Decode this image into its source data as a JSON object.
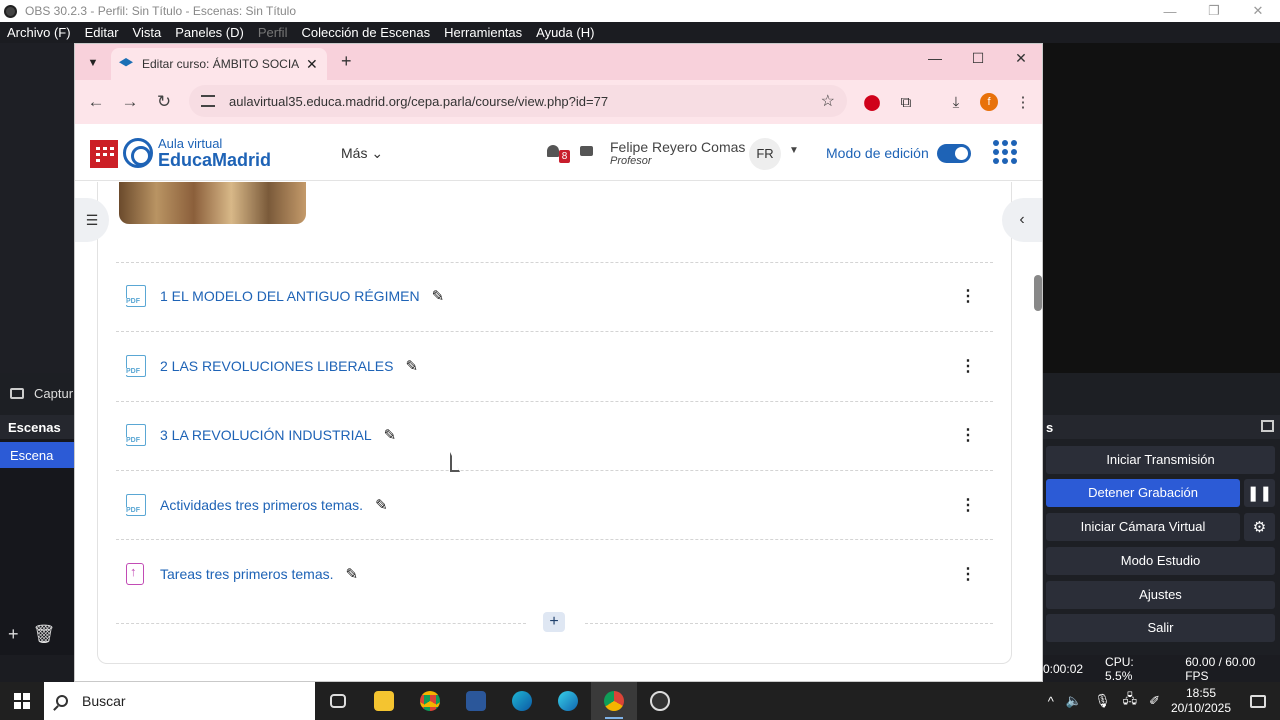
{
  "obs": {
    "title": "OBS 30.2.3 - Perfil: Sin Título - Escenas: Sin Título",
    "menu": [
      "Archivo (F)",
      "Editar",
      "Vista",
      "Paneles (D)",
      "Perfil",
      "Colección de Escenas",
      "Herramientas",
      "Ayuda (H)"
    ],
    "source_label": "Captur",
    "scenes_header": "Escenas",
    "scene_item": "Escena",
    "controls_header": "s",
    "controls": {
      "start_stream": "Iniciar Transmisión",
      "stop_record": "Detener Grabación",
      "virtual_cam": "Iniciar Cámara Virtual",
      "studio_mode": "Modo Estudio",
      "settings": "Ajustes",
      "exit": "Salir"
    },
    "status": {
      "rec_time": "0:00:02",
      "cpu": "CPU: 5.5%",
      "fps": "60.00 / 60.00 FPS"
    }
  },
  "chrome": {
    "tab_title": "Editar curso: ÁMBITO SOCIAL N",
    "url": "aulavirtual35.educa.madrid.org/cepa.parla/course/view.php?id=77",
    "profile_initial": "f"
  },
  "moodle": {
    "brand_top": "Aula virtual",
    "brand_main": "EducaMadrid",
    "more_menu": "Más",
    "notification_count": "8",
    "user_name": "Felipe Reyero Comas",
    "user_role": "Profesor",
    "user_initials": "FR",
    "edit_mode_label": "Modo de edición",
    "activities": [
      {
        "name": "1 EL MODELO DEL ANTIGUO RÉGIMEN",
        "type": "pdf"
      },
      {
        "name": "2 LAS REVOLUCIONES LIBERALES",
        "type": "pdf"
      },
      {
        "name": "3 LA REVOLUCIÓN INDUSTRIAL",
        "type": "pdf"
      },
      {
        "name": "Actividades tres primeros temas.",
        "type": "pdf"
      },
      {
        "name": "Tareas tres primeros temas.",
        "type": "assignment"
      }
    ]
  },
  "taskbar": {
    "search_placeholder": "Buscar",
    "time": "18:55",
    "date": "20/10/2025"
  },
  "colors": {
    "accent_blue": "#1e63b6",
    "obs_active": "#2c5bd6",
    "tab_pink": "#f8d1db"
  }
}
